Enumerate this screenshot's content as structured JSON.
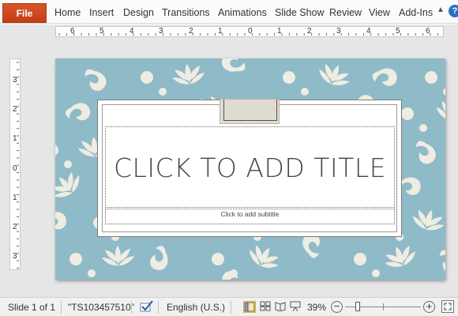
{
  "ribbon": {
    "file_label": "File",
    "tabs": [
      "Home",
      "Insert",
      "Design",
      "Transitions",
      "Animations",
      "Slide Show",
      "Review",
      "View",
      "Add-Ins"
    ],
    "collapse_icon": "chevron-up-icon",
    "help_icon": "question-icon",
    "help_label": "?"
  },
  "rulers": {
    "horizontal_labels": [
      "6",
      "5",
      "4",
      "3",
      "2",
      "1",
      "0",
      "1",
      "2",
      "3",
      "4",
      "5",
      "6"
    ],
    "vertical_labels": [
      "3",
      "2",
      "1",
      "0",
      "1",
      "2",
      "3"
    ]
  },
  "slide": {
    "title_placeholder": "CLICK TO ADD TITLE",
    "subtitle_placeholder": "Click to add  subtitle",
    "background_color": "#8fbac8",
    "pattern_color": "#efece2"
  },
  "statusbar": {
    "slide_indicator": "Slide 1 of 1",
    "theme_name": "\"TS103457510\"",
    "spellcheck_icon": "proofing-check-icon",
    "language": "English (U.S.)",
    "view_buttons": [
      "normal-view-icon",
      "slide-sorter-icon",
      "reading-view-icon",
      "slide-show-icon"
    ],
    "zoom_level": "39%",
    "zoom_out_label": "−",
    "zoom_in_label": "+",
    "fit_icon": "fit-slide-icon"
  }
}
